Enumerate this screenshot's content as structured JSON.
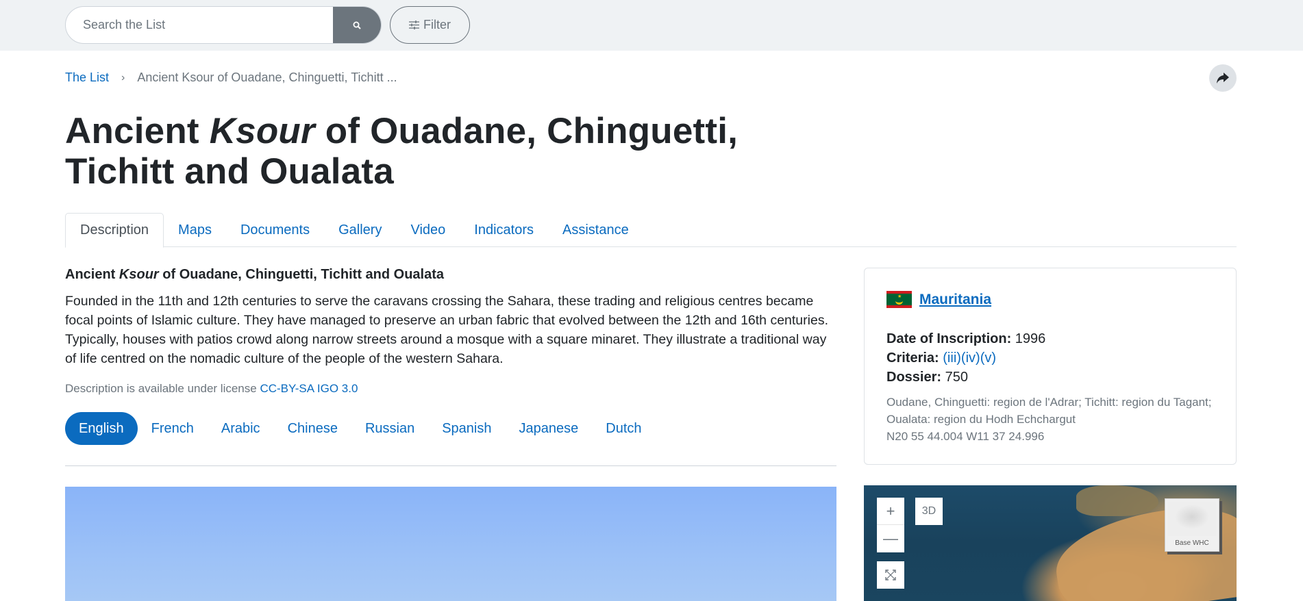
{
  "search": {
    "placeholder": "Search the List",
    "filter_label": "Filter"
  },
  "breadcrumb": {
    "root": "The List",
    "separator": "›",
    "current": "Ancient Ksour of Ouadane, Chinguetti, Tichitt ..."
  },
  "title": {
    "part1": "Ancient ",
    "italic": "Ksour",
    "part2": " of Ouadane, Chinguetti, Tichitt and Oualata"
  },
  "tabs": [
    {
      "label": "Description",
      "active": true
    },
    {
      "label": "Maps"
    },
    {
      "label": "Documents"
    },
    {
      "label": "Gallery"
    },
    {
      "label": "Video"
    },
    {
      "label": "Indicators"
    },
    {
      "label": "Assistance"
    }
  ],
  "description": {
    "heading_part1": "Ancient ",
    "heading_italic": "Ksour",
    "heading_part2": " of Ouadane, Chinguetti, Tichitt and Oualata",
    "text": "Founded in the 11th and 12th centuries to serve the caravans crossing the Sahara, these trading and religious centres became focal points of Islamic culture. They have managed to preserve an urban fabric that evolved between the 12th and 16th centuries. Typically, houses with patios crowd along narrow streets around a mosque with a square minaret. They illustrate a traditional way of life centred on the nomadic culture of the people of the western Sahara.",
    "license_prefix": "Description is available under license ",
    "license_link": "CC-BY-SA IGO 3.0"
  },
  "languages": [
    {
      "label": "English",
      "active": true
    },
    {
      "label": "French"
    },
    {
      "label": "Arabic"
    },
    {
      "label": "Chinese"
    },
    {
      "label": "Russian"
    },
    {
      "label": "Spanish"
    },
    {
      "label": "Japanese"
    },
    {
      "label": "Dutch"
    }
  ],
  "info": {
    "country": "Mauritania",
    "inscription_label": "Date of Inscription:",
    "inscription_value": "1996",
    "criteria_label": "Criteria:",
    "criteria_values": [
      "(iii)",
      "(iv)",
      "(v)"
    ],
    "dossier_label": "Dossier:",
    "dossier_value": "750",
    "region": "Oudane, Chinguetti: region de l'Adrar; Tichitt: region du Tagant; Oualata: region du Hodh Echchargut",
    "coordinates": "N20 55 44.004 W11 37 24.996"
  },
  "map": {
    "zoom_in": "+",
    "zoom_out": "—",
    "mode_3d": "3D",
    "basemap_label": "Base WHC"
  },
  "colors": {
    "accent": "#0b6bbf",
    "topbar_bg": "#eff2f4",
    "muted": "#6c757d"
  },
  "icons": {
    "search_button": "search-icon",
    "filter_button": "sliders-icon",
    "share_button": "share-icon",
    "map_fullscreen": "fullscreen-icon"
  }
}
